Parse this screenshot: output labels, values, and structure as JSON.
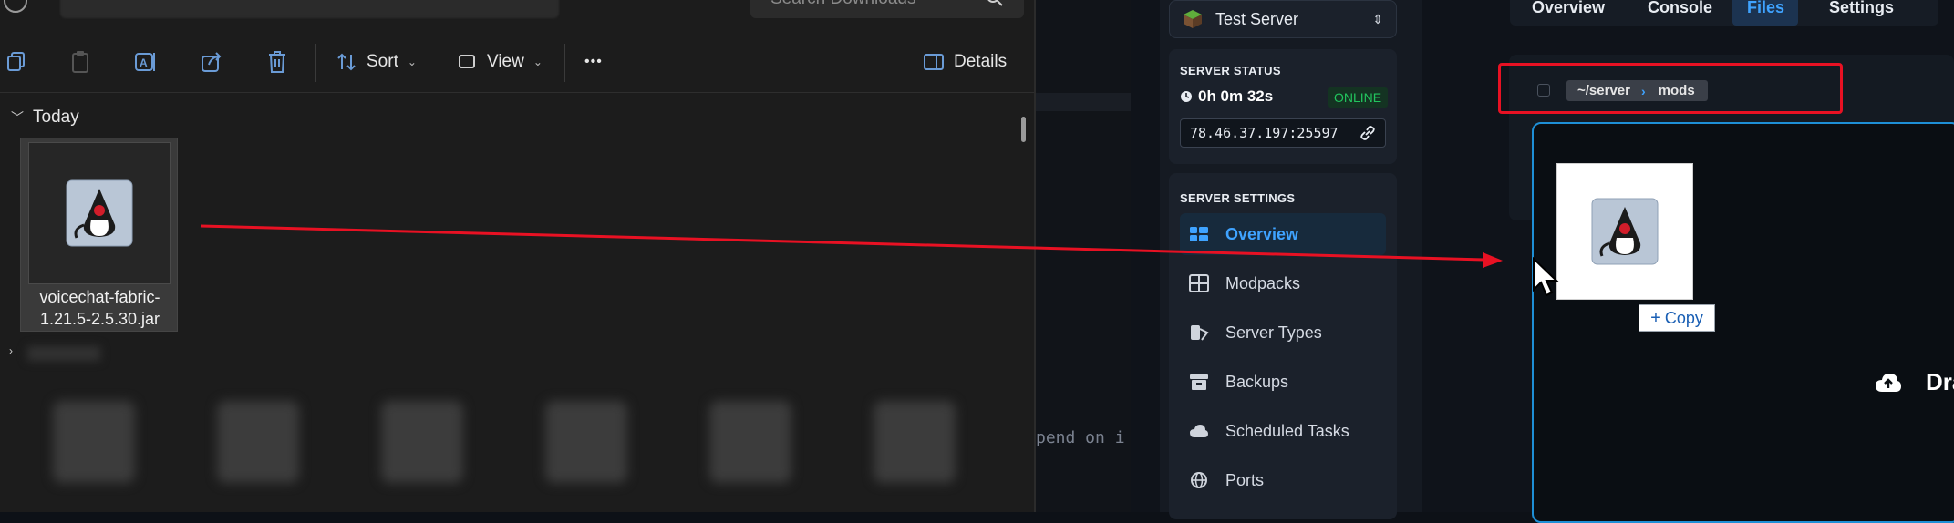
{
  "explorer": {
    "search_placeholder": "Search Downloads",
    "toolbar": {
      "sort_label": "Sort",
      "view_label": "View",
      "more_label": "•••",
      "details_label": "Details"
    },
    "group_label": "Today",
    "file": {
      "name": "voicechat-fabric-1.21.5-2.5.30.jar"
    }
  },
  "terminal": {
    "visible_text": "pend on i"
  },
  "server": {
    "selector_label": "Test Server",
    "status_heading": "SERVER STATUS",
    "uptime": "0h 0m 32s",
    "status_badge": "ONLINE",
    "address": "78.46.37.197:25597",
    "settings_heading": "SERVER SETTINGS",
    "nav": [
      {
        "label": "Overview",
        "icon": "overview-icon",
        "active": true
      },
      {
        "label": "Modpacks",
        "icon": "modpacks-icon",
        "active": false
      },
      {
        "label": "Server Types",
        "icon": "server-types-icon",
        "active": false
      },
      {
        "label": "Backups",
        "icon": "backups-icon",
        "active": false
      },
      {
        "label": "Scheduled Tasks",
        "icon": "cloud-icon",
        "active": false
      },
      {
        "label": "Ports",
        "icon": "globe-icon",
        "active": false
      }
    ]
  },
  "main": {
    "tabs": [
      {
        "label": "Overview",
        "active": false
      },
      {
        "label": "Console",
        "active": false
      },
      {
        "label": "Files",
        "active": true
      },
      {
        "label": "Settings",
        "active": false
      }
    ],
    "breadcrumb": {
      "root": "~/server",
      "current": "mods"
    },
    "drop_text": "Dra",
    "copy_tooltip": "Copy"
  },
  "colors": {
    "accent": "#3fa3ff",
    "online": "#22c55e",
    "annotation": "#e81123"
  }
}
